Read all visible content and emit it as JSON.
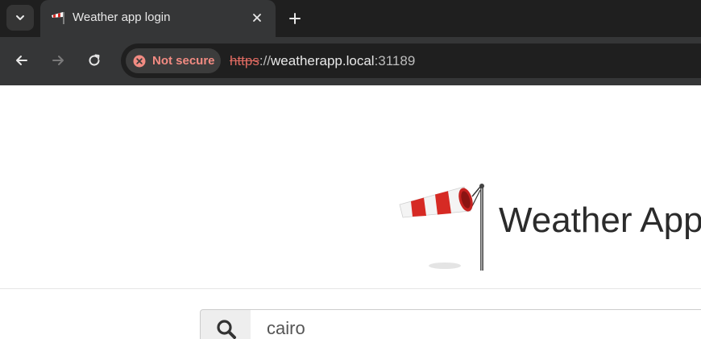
{
  "browser": {
    "tab": {
      "title": "Weather app login",
      "favicon": "windsock-icon"
    },
    "address_bar": {
      "security_label": "Not secure",
      "url_scheme": "https",
      "url_separator": "://",
      "url_host": "weatherapp.local",
      "url_port": ":31189"
    }
  },
  "page": {
    "logo": "windsock-icon",
    "title": "Weather App",
    "search": {
      "icon": "search-icon",
      "value": "cairo"
    }
  },
  "colors": {
    "chrome_dark": "#1f1f1f",
    "chrome_toolbar": "#353637",
    "warning_red": "#f28b82",
    "windsock_red": "#d62a24"
  }
}
